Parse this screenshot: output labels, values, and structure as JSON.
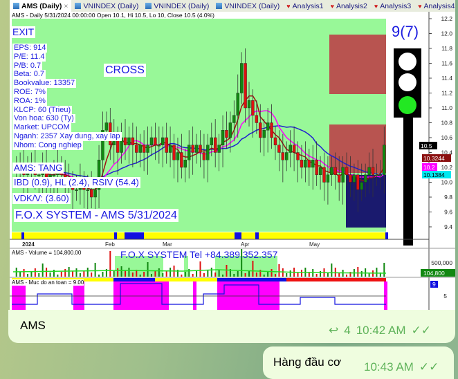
{
  "tabs": [
    {
      "label": "AMS (Daily)",
      "active": true,
      "close": "×"
    },
    {
      "label": "VNINDEX (Daily)"
    },
    {
      "label": "VNINDEX (Daily)"
    },
    {
      "label": "VNINDEX (Daily)"
    },
    {
      "label": "Analysis1"
    },
    {
      "label": "Analysis2"
    },
    {
      "label": "Analysis3"
    },
    {
      "label": "Analysis4"
    }
  ],
  "chart_header": "AMS - Daily 5/31/2024 00:00:00 Open 10.1, Hi 10.5, Lo 10, Close 10.5 (4.0%)",
  "overlay": {
    "exit": "EXIT",
    "cross": "CROSS",
    "stats": [
      "EPS: 914",
      "P/E: 11.4",
      "P/B: 0.7",
      "Beta: 0.7",
      "Bookvalue: 13357",
      "ROE: 7%",
      "ROA: 1%",
      "KLCP: 60 (Trieu)",
      "Von hoa: 630 (Ty)",
      "Market: UPCOM",
      "Nganh: 2357 Xay dung, xay lap",
      "Nhom: Cong nghiep"
    ],
    "signal": "AMS: TANG",
    "indicators": "IBD (0.9), HL (2.4), RSIV (54.4)",
    "vdk": "VDK/V:  (3.60)",
    "system": "F.O.X SYSTEM - AMS 5/31/2024",
    "score": "9(7)"
  },
  "chart_data": {
    "type": "candlestick",
    "y_ticks": [
      "12.2",
      "12.0",
      "11.8",
      "11.6",
      "11.4",
      "11.2",
      "11.0",
      "10.8",
      "10.6",
      "10.4",
      "10.2",
      "10.0",
      "9.8",
      "9.6",
      "9.4"
    ],
    "ylim": [
      9.4,
      12.2
    ],
    "x_labels": [
      "2024",
      "Feb",
      "Mar",
      "Apr",
      "May"
    ],
    "close": [
      10.2,
      10.2,
      10.1,
      10.2,
      10.2,
      10.1,
      10.1,
      10.2,
      10.0,
      10.1,
      10.1,
      10.2,
      10.1,
      10.0,
      10.0,
      9.9,
      9.9,
      10.0,
      9.9,
      9.9,
      9.8,
      9.9,
      10.3,
      10.7,
      10.8,
      10.5,
      10.6,
      10.4,
      10.6,
      10.5,
      10.6,
      10.5,
      10.4,
      10.5,
      10.4,
      10.5,
      10.6,
      10.5,
      10.5,
      10.6,
      10.4,
      10.5,
      10.3,
      10.4,
      10.2,
      10.3,
      10.5,
      10.4,
      10.5,
      10.4,
      10.3,
      10.5,
      10.6,
      10.4,
      10.5,
      10.7,
      10.6,
      10.8,
      10.9,
      11.2,
      11.6,
      11.0,
      11.1,
      10.9,
      10.8,
      10.6,
      10.7,
      10.8,
      10.6,
      10.5,
      10.4,
      10.3,
      10.4,
      10.5,
      10.4,
      10.3,
      10.2,
      10.3,
      10.2,
      10.3,
      10.1,
      10.2,
      10.0,
      10.1,
      10.2,
      10.1,
      10.0,
      10.2,
      10.1,
      10.0,
      10.1,
      9.9,
      10.0,
      10.1,
      10.2,
      10.1,
      10.1,
      10.1,
      10.5
    ],
    "price_tags": [
      {
        "label": "10.5",
        "color": "#000000"
      },
      {
        "label": "10.3244",
        "color": "#8b1010"
      },
      {
        "label": "10.2",
        "color": "#ff00ff"
      },
      {
        "label": "10.1384",
        "color": "#00e8f0"
      }
    ],
    "volume": {
      "title": "AMS - Volume = 104,800.00",
      "watermark": "F.O.X SYSTEM Tel +84.389.352.357",
      "tick": "500,000",
      "last_tag": "104,800"
    },
    "safety": {
      "title": "AMS - Muc do an toan = 9.00",
      "tick": "5",
      "last_tag": "9"
    }
  },
  "messages": [
    {
      "text": "AMS",
      "replies": "4",
      "time": "10:42 AM"
    },
    {
      "text": "Hàng đầu cơ",
      "time": "10:43 AM"
    }
  ],
  "colors": {
    "plot_bg": "#98f898",
    "red_zone": "#b85450",
    "navy_zone": "#1a1a6e",
    "light_green": "#22e822"
  }
}
